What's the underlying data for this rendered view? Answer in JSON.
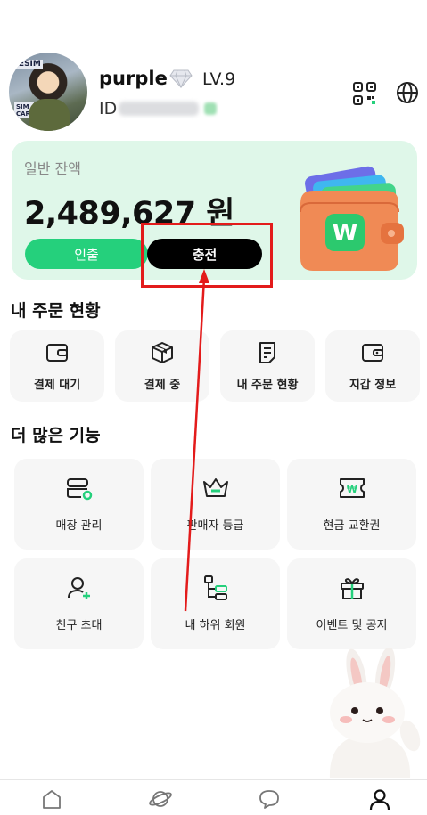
{
  "header": {
    "username": "purple",
    "level": "LV.9",
    "id_label": "ID",
    "avatar_text_1": "RESIM",
    "avatar_text_2": "SIM CARDS",
    "icons": [
      "qr-code-icon",
      "globe-icon",
      "diamond-icon"
    ]
  },
  "balance": {
    "label": "일반 잔액",
    "value": "2,489,627 원",
    "withdraw_label": "인출",
    "charge_label": "충전",
    "wallet_logo": "W"
  },
  "orders": {
    "title": "내 주문 현황",
    "items": [
      {
        "label": "결제 대기",
        "icon": "wallet-icon"
      },
      {
        "label": "결제 중",
        "icon": "box-icon"
      },
      {
        "label": "내 주문 현황",
        "icon": "document-icon"
      },
      {
        "label": "지갑 정보",
        "icon": "wallet-info-icon"
      }
    ]
  },
  "features": {
    "title": "더 많은 기능",
    "items": [
      {
        "label": "매장 관리",
        "icon": "store-settings-icon"
      },
      {
        "label": "판매자 등급",
        "icon": "crown-icon"
      },
      {
        "label": "현금 교환권",
        "icon": "cash-voucher-icon"
      },
      {
        "label": "친구 초대",
        "icon": "add-user-icon"
      },
      {
        "label": "내 하위 회원",
        "icon": "hierarchy-icon"
      },
      {
        "label": "이벤트 및 공지",
        "icon": "gift-icon"
      }
    ]
  },
  "nav": {
    "items": [
      "home-icon",
      "planet-icon",
      "chat-icon",
      "profile-icon"
    ],
    "active": "profile-icon"
  },
  "colors": {
    "accent_green": "#25d07c",
    "card_bg": "#dff7e9",
    "highlight_red": "#e31b1b"
  }
}
